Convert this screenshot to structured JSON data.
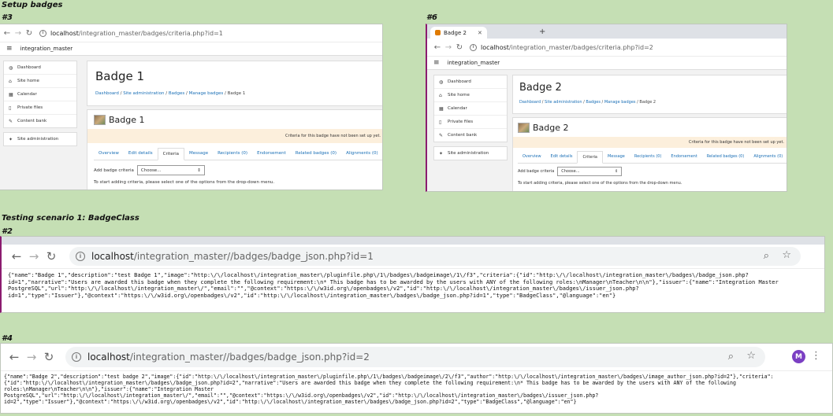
{
  "captions": {
    "setup": "Setup badges",
    "testing": "Testing scenario 1: BadgeClass"
  },
  "panel3": {
    "num": "#3",
    "url_host": "localhost",
    "url_path": "/integration_master/badges/criteria.php?id=1",
    "site_name": "integration_master",
    "sidebar": [
      [
        {
          "icon": "◍",
          "label": "Dashboard"
        },
        {
          "icon": "⌂",
          "label": "Site home"
        },
        {
          "icon": "▦",
          "label": "Calendar"
        },
        {
          "icon": "▯",
          "label": "Private files"
        },
        {
          "icon": "✎",
          "label": "Content bank"
        }
      ],
      [
        {
          "icon": "✦",
          "label": "Site administration"
        }
      ]
    ],
    "page_title": "Badge 1",
    "breadcrumb": [
      "Dashboard",
      "Site administration",
      "Badges",
      "Manage badges",
      "Badge 1"
    ],
    "badge_name": "Badge 1",
    "alert": "Criteria for this badge have not been set up yet.",
    "tabs": [
      "Overview",
      "Edit details",
      "Criteria",
      "Message",
      "Recipients (0)",
      "Endorsement",
      "Related badges (0)",
      "Alignments (0)"
    ],
    "active_tab": "Criteria",
    "add_label": "Add badge criteria",
    "select_value": "Choose...",
    "hint": "To start adding criteria, please select one of the options from the drop-down menu."
  },
  "panel6": {
    "num": "#6",
    "tab_title": "Badge 2",
    "url_host": "localhost",
    "url_path": "/integration_master/badges/criteria.php?id=2",
    "site_name": "integration_master",
    "sidebar": [
      [
        {
          "icon": "◍",
          "label": "Dashboard"
        },
        {
          "icon": "⌂",
          "label": "Site home"
        },
        {
          "icon": "▦",
          "label": "Calendar"
        },
        {
          "icon": "▯",
          "label": "Private files"
        },
        {
          "icon": "✎",
          "label": "Content bank"
        }
      ],
      [
        {
          "icon": "✦",
          "label": "Site administration"
        }
      ]
    ],
    "page_title": "Badge 2",
    "breadcrumb": [
      "Dashboard",
      "Site administration",
      "Badges",
      "Manage badges",
      "Badge 2"
    ],
    "badge_name": "Badge 2",
    "alert": "Criteria for this badge have not been set up yet.",
    "tabs": [
      "Overview",
      "Edit details",
      "Criteria",
      "Message",
      "Recipients (0)",
      "Endorsement",
      "Related badges (0)",
      "Alignments (0)"
    ],
    "active_tab": "Criteria",
    "add_label": "Add badge criteria",
    "select_value": "Choose...",
    "hint": "To start adding criteria, please select one of the options from the drop-down menu."
  },
  "panel2": {
    "num": "#2",
    "url_host": "localhost",
    "url_path": "/integration_master//badges/badge_json.php?id=1",
    "json_lines": [
      "{\"name\":\"Badge 1\",\"description\":\"test Badge 1\",\"image\":\"http:\\/\\/localhost\\/integration_master\\/pluginfile.php\\/1\\/badges\\/badgeimage\\/1\\/f3\",\"criteria\":{\"id\":\"http:\\/\\/localhost\\/integration_master\\/badges\\/badge_json.php?",
      "id=1\",\"narrative\":\"Users are awarded this badge when they complete the following requirement:\\n* This badge has to be awarded by the users with ANY of the following roles:\\nManager\\nTeacher\\n\\n\"},\"issuer\":{\"name\":\"Integration Master",
      "PostgreSQL\",\"url\":\"http:\\/\\/localhost\\/integration_master\\/\",\"email\":\"\",\"@context\":\"https:\\/\\/w3id.org\\/openbadges\\/v2\",\"id\":\"http:\\/\\/localhost\\/integration_master\\/badges\\/issuer_json.php?",
      "id=1\",\"type\":\"Issuer\"},\"@context\":\"https:\\/\\/w3id.org\\/openbadges\\/v2\",\"id\":\"http:\\/\\/localhost\\/integration_master\\/badges\\/badge_json.php?id=1\",\"type\":\"BadgeClass\",\"@language\":\"en\"}"
    ]
  },
  "panel4": {
    "num": "#4",
    "url_host": "localhost",
    "url_path": "/integration_master//badges/badge_json.php?id=2",
    "avatar": "M",
    "json_lines": [
      "{\"name\":\"Badge 2\",\"description\":\"test badge 2\",\"image\":{\"id\":\"http:\\/\\/localhost\\/integration_master\\/pluginfile.php\\/1\\/badges\\/badgeimage\\/2\\/f3\",\"author\":\"http:\\/\\/localhost\\/integration_master\\/badges\\/image_author_json.php?id=2\"},\"criteria\":",
      "{\"id\":\"http:\\/\\/localhost\\/integration_master\\/badges\\/badge_json.php?id=2\",\"narrative\":\"Users are awarded this badge when they complete the following requirement:\\n* This badge has to be awarded by the users with ANY of the following",
      "roles:\\nManager\\nTeacher\\n\\n\"},\"issuer\":{\"name\":\"Integration Master",
      "PostgreSQL\",\"url\":\"http:\\/\\/localhost\\/integration_master\\/\",\"email\":\"\",\"@context\":\"https:\\/\\/w3id.org\\/openbadges\\/v2\",\"id\":\"http:\\/\\/localhost\\/integration_master\\/badges\\/issuer_json.php?",
      "id=2\",\"type\":\"Issuer\"},\"@context\":\"https:\\/\\/w3id.org\\/openbadges\\/v2\",\"id\":\"http:\\/\\/localhost\\/integration_master\\/badges\\/badge_json.php?id=2\",\"type\":\"BadgeClass\",\"@language\":\"en\"}"
    ]
  }
}
